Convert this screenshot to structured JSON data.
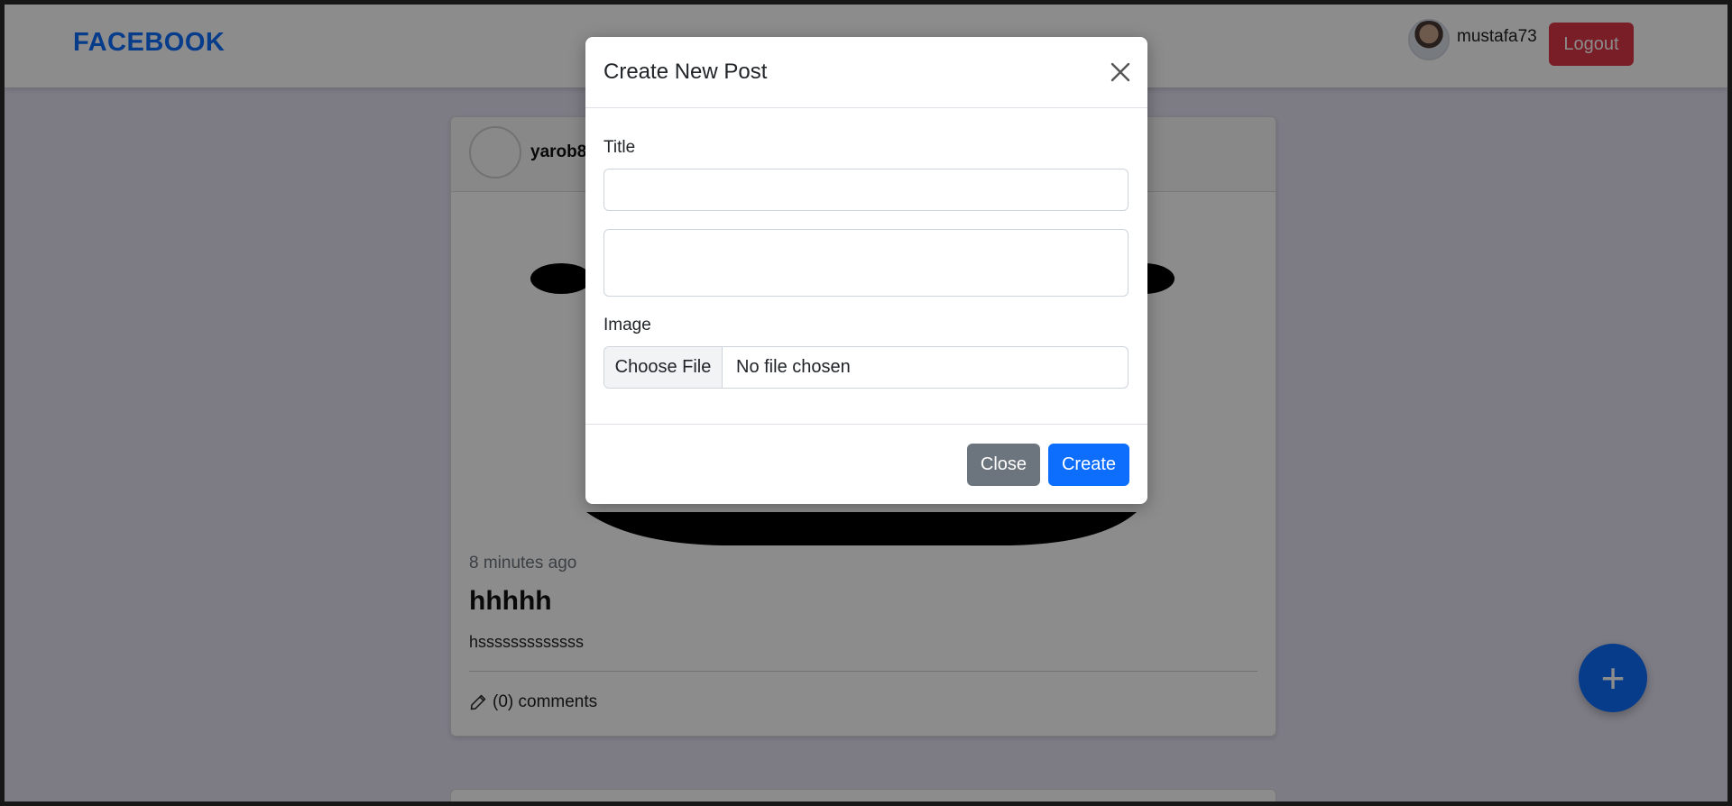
{
  "navbar": {
    "brand": "FACEBOOK",
    "username": "mustafa73",
    "logout_label": "Logout"
  },
  "post": {
    "author": "yarob8",
    "time": "8 minutes ago",
    "title": "hhhhh",
    "body": "hsssssssssssss",
    "comments": "(0) comments"
  },
  "fab": {
    "label": "+"
  },
  "modal": {
    "title": "Create New Post",
    "title_label": "Title",
    "title_value": "",
    "body_value": "",
    "image_label": "Image",
    "file_button": "Choose File",
    "file_status": "No file chosen",
    "close_label": "Close",
    "create_label": "Create"
  },
  "colors": {
    "brand": "#0d6efd",
    "danger": "#dc3545",
    "secondary": "#6c757d",
    "primary": "#0d6efd"
  }
}
